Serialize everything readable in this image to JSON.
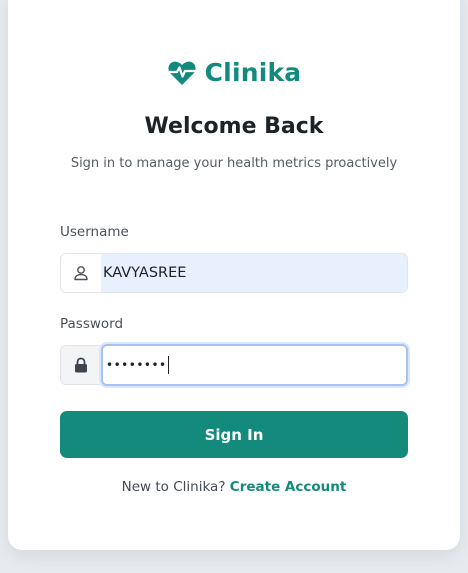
{
  "brand": {
    "name": "Clinika",
    "logo_icon": "heart-pulse-icon",
    "accent_color": "#138a7c"
  },
  "header": {
    "title": "Welcome Back",
    "subtitle": "Sign in to manage your health metrics proactively"
  },
  "form": {
    "username": {
      "label": "Username",
      "value": "KAVYASREE",
      "icon": "user-icon"
    },
    "password": {
      "label": "Password",
      "masked_value": "••••••••",
      "icon": "lock-icon"
    },
    "submit_label": "Sign In"
  },
  "footer": {
    "prompt": "New to Clinika?",
    "link_label": "Create Account"
  }
}
